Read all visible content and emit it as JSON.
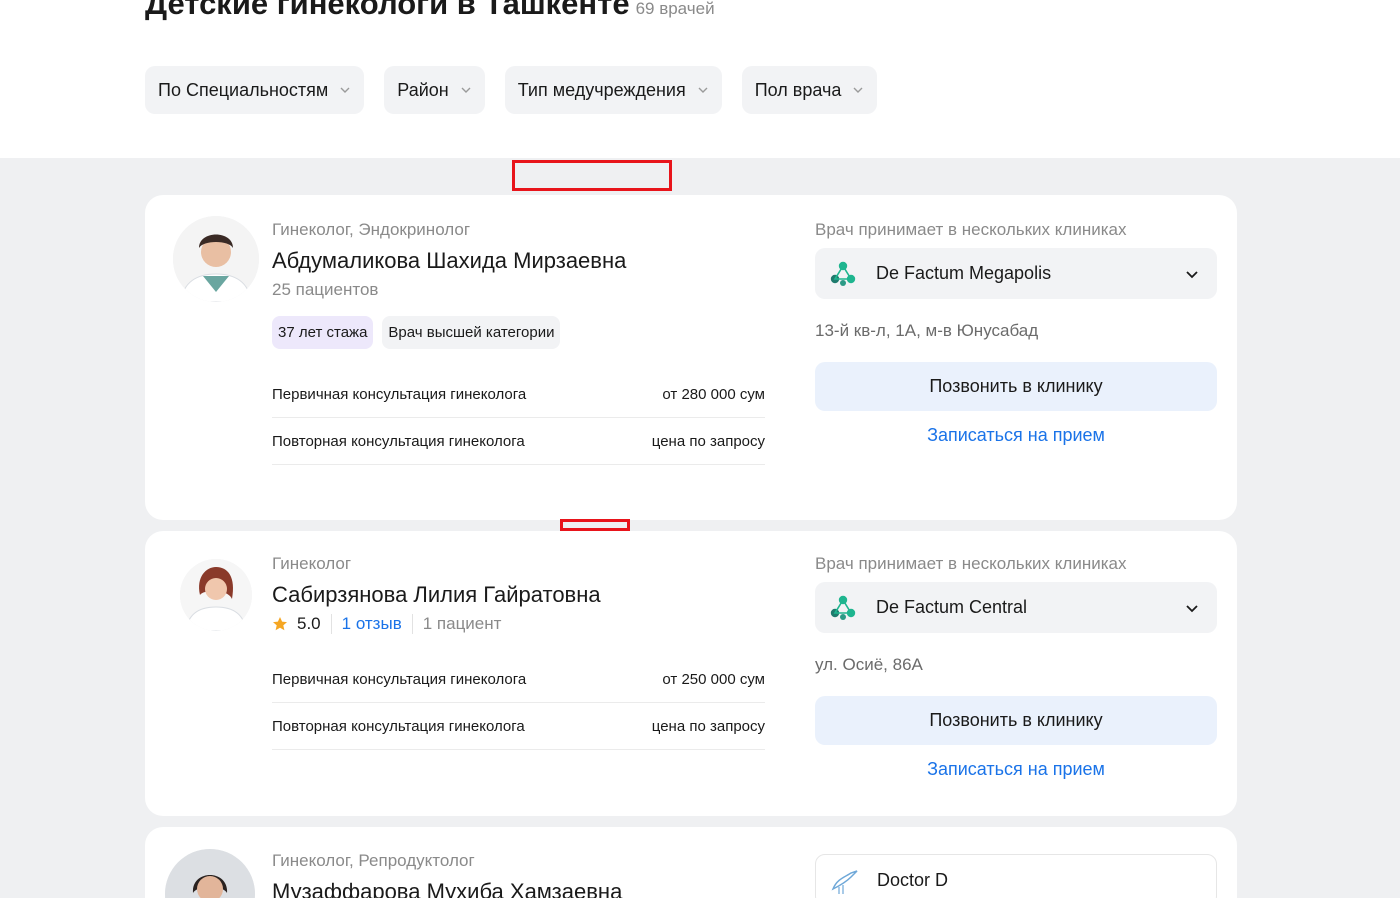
{
  "header": {
    "title": "Детские гинекологи в Ташкенте",
    "count": "69 врачей"
  },
  "filters": [
    {
      "label": "По Специальностям"
    },
    {
      "label": "Район"
    },
    {
      "label": "Тип медучреждения"
    },
    {
      "label": "Пол врача"
    }
  ],
  "doctors": [
    {
      "specialty": "Гинеколог, Эндокринолог",
      "name": "Абдумаликова Шахида Мирзаевна",
      "patients": "25 пациентов",
      "tags": [
        "37 лет стажа",
        "Врач высшей категории"
      ],
      "prices": [
        {
          "service": "Первичная консультация гинеколога",
          "price": "от 280 000 сум"
        },
        {
          "service": "Повторная консультация гинеколога",
          "price": "цена по запросу"
        }
      ],
      "clinic_note": "Врач принимает в нескольких клиниках",
      "clinic": "De Factum Megapolis",
      "address": "13-й кв-л, 1А, м-в Юнусабад",
      "call_label": "Позвонить в клинику",
      "book_label": "Записаться на прием"
    },
    {
      "specialty": "Гинеколог",
      "name": "Сабирзянова Лилия Гайратовна",
      "rating": "5.0",
      "reviews": "1 отзыв",
      "patients": "1 пациент",
      "prices": [
        {
          "service": "Первичная консультация гинеколога",
          "price": "от 250 000 сум"
        },
        {
          "service": "Повторная консультация гинеколога",
          "price": "цена по запросу"
        }
      ],
      "clinic_note": "Врач принимает в нескольких клиниках",
      "clinic": "De Factum Central",
      "address": "ул. Осиё, 86А",
      "call_label": "Позвонить в клинику",
      "book_label": "Записаться на прием"
    },
    {
      "specialty": "Гинеколог, Репродуктолог",
      "name": "Музаффарова Мухиба Хамзаевна",
      "clinic": "Doctor D"
    }
  ],
  "colors": {
    "accent_link": "#1a73e8",
    "call_button_bg": "#eaf1fc",
    "list_bg": "#eff0f2",
    "marker": "#e8141b",
    "star": "#f5a623",
    "clinic_logo": "#1fb58f"
  },
  "icons": {
    "filter_chevron": "chevron-down-icon",
    "clinic_chevron": "chevron-down-icon",
    "rating": "star-icon",
    "clinic_logo": "de-factum-logo-icon",
    "clinic_logo_3": "stork-logo-icon"
  }
}
